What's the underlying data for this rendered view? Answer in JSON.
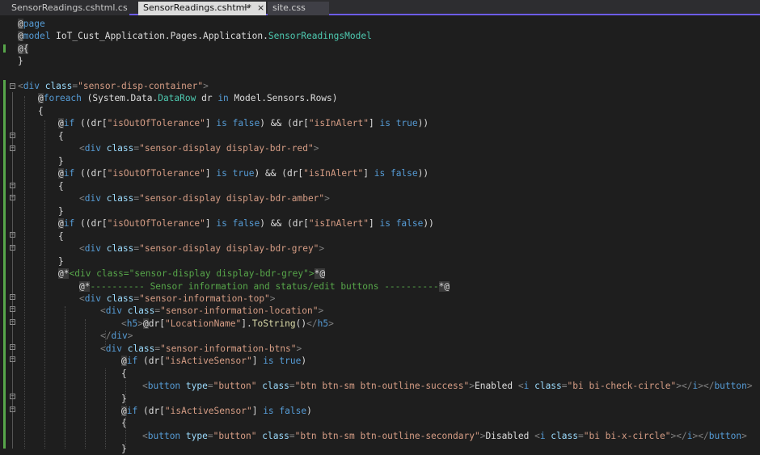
{
  "tabs": [
    {
      "label": "SensorReadings.cshtml.cs"
    },
    {
      "label": "SensorReadings.cshtml*",
      "pin": "⊸",
      "close": "×"
    },
    {
      "label": "site.css"
    }
  ],
  "code": {
    "l1": {
      "a": "@",
      "b": "page"
    },
    "l2": {
      "a": "@",
      "b": "model",
      "c": " IoT_Cust_Application.Pages.Application.",
      "d": "SensorReadingsModel"
    },
    "l3": {
      "a": "@{"
    },
    "l4": {
      "a": "}"
    },
    "l6": {
      "a": "<",
      "b": "div",
      "c": " class",
      "d": "=",
      "e": "\"sensor-disp-container\"",
      "f": ">"
    },
    "l7": {
      "a": "@",
      "b": "foreach",
      "c": " (System.Data.",
      "d": "DataRow",
      "e": " dr ",
      "f": "in",
      "g": " Model.Sensors.Rows)"
    },
    "l8": {
      "a": "{"
    },
    "l9": {
      "a": "@",
      "b": "if",
      "c": " ((dr[",
      "d": "\"isOutOfTolerance\"",
      "e": "] ",
      "f": "is false",
      "g": ") && (dr[",
      "h": "\"isInAlert\"",
      "i": "] ",
      "j": "is true",
      "k": "))"
    },
    "l10": {
      "a": "{"
    },
    "l11": {
      "a": "<",
      "b": "div",
      "c": " class",
      "d": "=",
      "e": "\"sensor-display display-bdr-red\"",
      "f": ">"
    },
    "l12": {
      "a": "}"
    },
    "l13": {
      "a": "@",
      "b": "if",
      "c": " ((dr[",
      "d": "\"isOutOfTolerance\"",
      "e": "] ",
      "f": "is true",
      "g": ") && (dr[",
      "h": "\"isInAlert\"",
      "i": "] ",
      "j": "is false",
      "k": "))"
    },
    "l14": {
      "a": "{"
    },
    "l15": {
      "a": "<",
      "b": "div",
      "c": " class",
      "d": "=",
      "e": "\"sensor-display display-bdr-amber\"",
      "f": ">"
    },
    "l16": {
      "a": "}"
    },
    "l17": {
      "a": "@",
      "b": "if",
      "c": " ((dr[",
      "d": "\"isOutOfTolerance\"",
      "e": "] ",
      "f": "is false",
      "g": ") && (dr[",
      "h": "\"isInAlert\"",
      "i": "] ",
      "j": "is false",
      "k": "))"
    },
    "l18": {
      "a": "{"
    },
    "l19": {
      "a": "<",
      "b": "div",
      "c": " class",
      "d": "=",
      "e": "\"sensor-display display-bdr-grey\"",
      "f": ">"
    },
    "l20": {
      "a": "}"
    },
    "l21": {
      "a": "@*",
      "b": "<div class=\"sensor-display display-bdr-grey\">",
      "c": "*@"
    },
    "l22": {
      "a": "@*",
      "b": "---------- Sensor information and status/edit buttons ----------",
      "c": "*@"
    },
    "l23": {
      "a": "<",
      "b": "div",
      "c": " class",
      "d": "=",
      "e": "\"sensor-information-top\"",
      "f": ">"
    },
    "l24": {
      "a": "<",
      "b": "div",
      "c": " class",
      "d": "=",
      "e": "\"sensor-information-location\"",
      "f": ">"
    },
    "l25": {
      "a": "<",
      "b": "h5",
      "c": ">",
      "d": "@",
      "e": "dr[",
      "f": "\"LocationName\"",
      "g": "].",
      "h": "ToString",
      "i": "()",
      "j": "</",
      "k": "h5",
      "l": ">"
    },
    "l26": {
      "a": "</",
      "b": "div",
      "c": ">"
    },
    "l27": {
      "a": "<",
      "b": "div",
      "c": " class",
      "d": "=",
      "e": "\"sensor-information-btns\"",
      "f": ">"
    },
    "l28": {
      "a": "@",
      "b": "if",
      "c": " (dr[",
      "d": "\"isActiveSensor\"",
      "e": "] ",
      "f": "is true",
      "g": ")"
    },
    "l29": {
      "a": "{"
    },
    "l30": {
      "a": "<",
      "b": "button",
      "c": " type",
      "d": "=",
      "e": "\"button\"",
      "f": " class",
      "g": "=",
      "h": "\"btn btn-sm btn-outline-success\"",
      "i": ">",
      "j": "Enabled ",
      "k": "<",
      "l": "i",
      "m": " class",
      "n": "=",
      "o": "\"bi bi-check-circle\"",
      "p": "></",
      "q": "i",
      "r": "></",
      "s": "button",
      "t": ">"
    },
    "l31": {
      "a": "}"
    },
    "l32": {
      "a": "@",
      "b": "if",
      "c": " (dr[",
      "d": "\"isActiveSensor\"",
      "e": "] ",
      "f": "is false",
      "g": ")"
    },
    "l33": {
      "a": "{"
    },
    "l34": {
      "a": "<",
      "b": "button",
      "c": " type",
      "d": "=",
      "e": "\"button\"",
      "f": " class",
      "g": "=",
      "h": "\"btn btn-sm btn-outline-secondary\"",
      "i": ">",
      "j": "Disabled ",
      "k": "<",
      "l": "i",
      "m": " class",
      "n": "=",
      "o": "\"bi bi-x-circle\"",
      "p": "></",
      "q": "i",
      "r": "></",
      "s": "button",
      "t": ">"
    },
    "l35": {
      "a": "}"
    }
  }
}
